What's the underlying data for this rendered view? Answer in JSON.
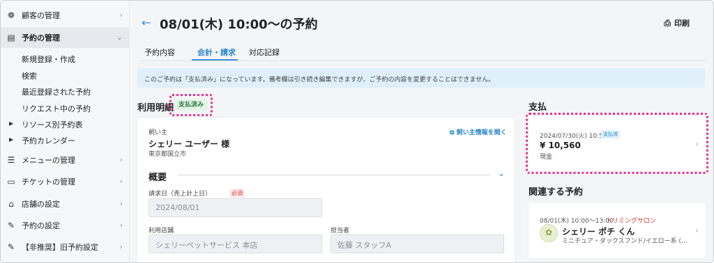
{
  "sidebar": {
    "items": [
      {
        "label": "顧客の管理",
        "icon": "paw-icon"
      },
      {
        "label": "予約の管理",
        "icon": "calendar-icon"
      },
      {
        "label": "メニューの管理",
        "icon": "list-icon"
      },
      {
        "label": "チケットの管理",
        "icon": "ticket-icon"
      },
      {
        "label": "店舗の設定",
        "icon": "home-icon"
      },
      {
        "label": "予約の設定",
        "icon": "edit-icon"
      },
      {
        "label": "【非推奨】旧予約設定",
        "icon": "edit-icon"
      }
    ],
    "sub_items": [
      "新規登録・作成",
      "検索",
      "最近登録された予約",
      "リクエスト中の予約",
      "リソース別予約表",
      "予約カレンダー"
    ]
  },
  "header": {
    "title": "08/01(木) 10:00〜の予約",
    "print_label": "印刷"
  },
  "tabs": [
    "予約内容",
    "会計・請求",
    "対応記録"
  ],
  "banner": "このご予約は「支払済み」になっています。備考欄は引き続き編集できますが、ご予約の内容を変更することはできません。",
  "usage": {
    "title": "利用明細",
    "status": "支払済み",
    "owner_label": "飼い主",
    "owner_name": "シェリー ユーザー 様",
    "owner_address": "東京都国立市",
    "open_owner_link": "飼い主情報を開く",
    "overview_title": "概要",
    "billing_date_label": "請求日（売上計上日）",
    "required_label": "必須",
    "billing_date_value": "2024/08/01",
    "store_label": "利用店舗",
    "store_value": "シェリーペットサービス 本店",
    "staff_label": "担当者",
    "staff_value": "佐藤 スタッフA"
  },
  "payment": {
    "title": "支払",
    "datetime": "2024/07/30(火) 10:55",
    "badge": "支払済",
    "amount": "¥ 10,560",
    "method": "現金"
  },
  "related": {
    "title": "関連する予約",
    "time": "08/01(木) 10:00〜13:00",
    "service": "トリミングサロン",
    "pet_name": "シェリー ポチ くん",
    "pet_breed": "ミニチュア・ダックスフンド/イエロー系 (…"
  },
  "colors": {
    "accent": "#3a8fd8",
    "highlight": "#e8348c",
    "badge_green": "#2b7a3e",
    "required_red": "#d03b3b"
  }
}
